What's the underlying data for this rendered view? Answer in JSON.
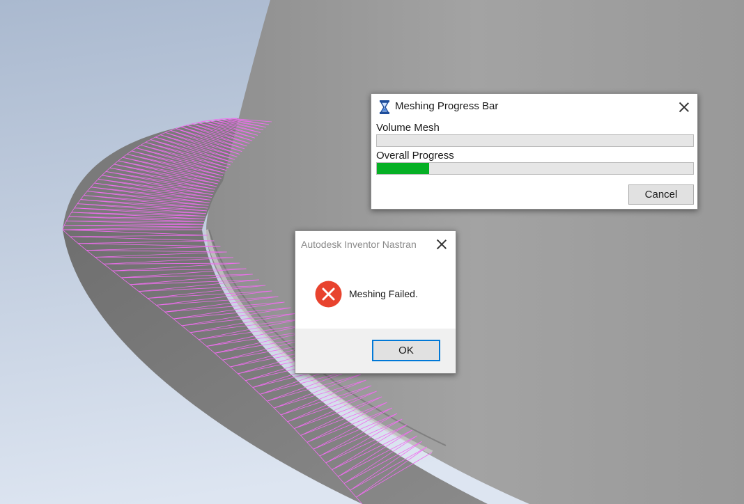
{
  "colors": {
    "sky_top": "#aab9cf",
    "sky_bottom": "#dde5f1",
    "body_grey": "#9b9b9b",
    "mesh_face": "#7c7c7c",
    "mesh_edge": "#f06ef0",
    "progress_green": "#06b025",
    "error_red": "#e8432e",
    "ok_border": "#0078d7"
  },
  "progress_dialog": {
    "icon": "hourglass-icon",
    "title": "Meshing Progress Bar",
    "volume_mesh_label": "Volume Mesh",
    "volume_mesh_progress": 0,
    "overall_progress_label": "Overall Progress",
    "overall_progress": 0.165,
    "cancel_label": "Cancel"
  },
  "error_dialog": {
    "title": "Autodesk Inventor Nastran",
    "icon": "error-icon",
    "message": "Meshing Failed.",
    "ok_label": "OK"
  }
}
